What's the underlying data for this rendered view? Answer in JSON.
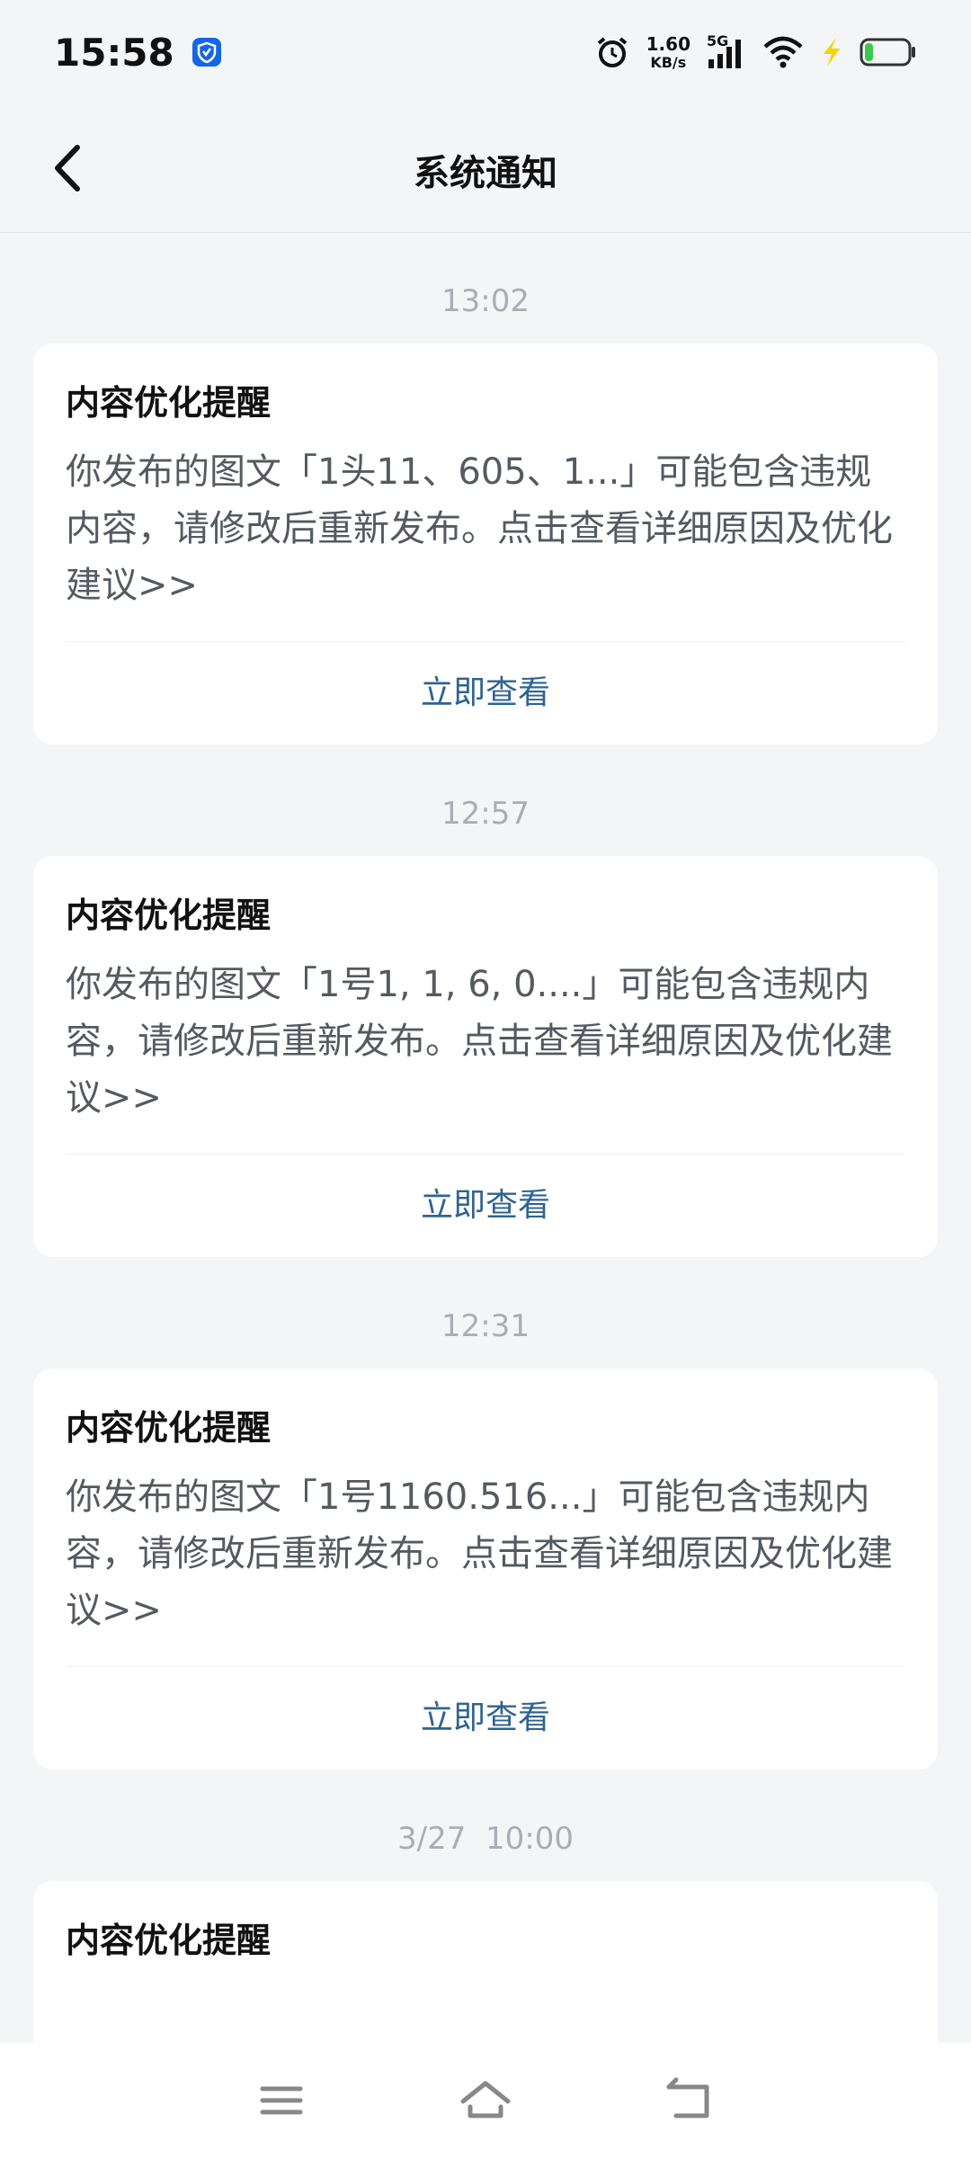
{
  "status_bar": {
    "time": "15:58",
    "net_speed_value": "1.60",
    "net_speed_unit": "KB/s",
    "network_type": "5G",
    "battery_level": 0.2,
    "icons": [
      "shield-icon",
      "alarm-icon",
      "signal-icon",
      "wifi-icon",
      "charging-icon",
      "battery-icon"
    ]
  },
  "header": {
    "title": "系统通知"
  },
  "notifications": [
    {
      "time": "13:02",
      "title": "内容优化提醒",
      "body": "你发布的图文「1头11、605、1...」可能包含违规内容，请修改后重新发布。点击查看详细原因及优化建议>>",
      "action": "立即查看"
    },
    {
      "time": "12:57",
      "title": "内容优化提醒",
      "body": "你发布的图文「1号1, 1, 6, 0....」可能包含违规内容，请修改后重新发布。点击查看详细原因及优化建议>>",
      "action": "立即查看"
    },
    {
      "time": "12:31",
      "title": "内容优化提醒",
      "body": "你发布的图文「1号1160.516...」可能包含违规内容，请修改后重新发布。点击查看详细原因及优化建议>>",
      "action": "立即查看"
    },
    {
      "time": "3/27  10:00",
      "title": "内容优化提醒"
    }
  ],
  "system_nav": {
    "icons": [
      "menu-icon",
      "home-icon",
      "back-nav-icon"
    ]
  }
}
